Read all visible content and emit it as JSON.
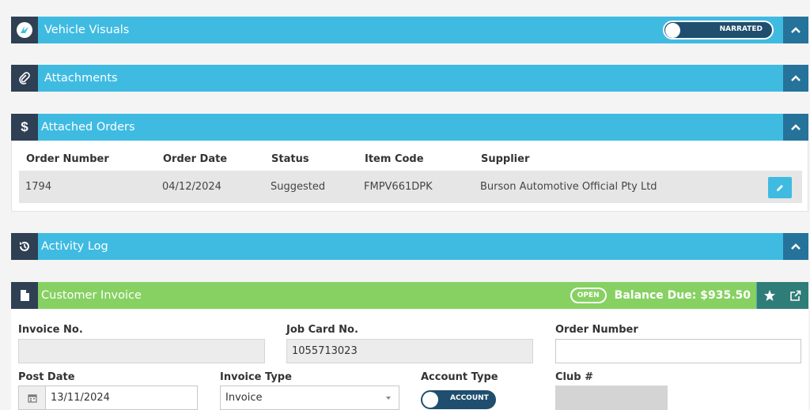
{
  "vehicle_visuals": {
    "title": "Vehicle Visuals",
    "toggle_label": "NARRATED",
    "icon": "vehicle-logo-icon"
  },
  "attachments": {
    "title": "Attachments",
    "icon": "paperclip-icon"
  },
  "attached_orders": {
    "title": "Attached Orders",
    "icon": "dollar-icon",
    "columns": [
      "Order Number",
      "Order Date",
      "Status",
      "Item Code",
      "Supplier"
    ],
    "rows": [
      {
        "order_number": "1794",
        "order_date": "04/12/2024",
        "status": "Suggested",
        "item_code": "FMPV661DPK",
        "supplier": "Burson Automotive Official Pty Ltd"
      }
    ]
  },
  "activity_log": {
    "title": "Activity Log",
    "icon": "history-icon"
  },
  "customer_invoice": {
    "title": "Customer Invoice",
    "icon": "document-icon",
    "status_badge": "OPEN",
    "balance_due": "Balance Due: $935.50",
    "fields": {
      "invoice_no": {
        "label": "Invoice No.",
        "value": ""
      },
      "job_card_no": {
        "label": "Job Card No.",
        "value": "1055713023"
      },
      "order_number": {
        "label": "Order Number",
        "value": ""
      },
      "post_date": {
        "label": "Post Date",
        "value": "13/11/2024"
      },
      "invoice_type": {
        "label": "Invoice Type",
        "value": "Invoice"
      },
      "account_type": {
        "label": "Account Type",
        "toggle_label": "ACCOUNT"
      },
      "club_no": {
        "label": "Club #"
      }
    }
  },
  "colors": {
    "panel_blue": "#3fbbe2",
    "panel_dark": "#2f4054",
    "collapse_blue": "#25739a",
    "invoice_green": "#86d162",
    "action_teal": "#2f7d78",
    "toggle_navy": "#1f4e6e"
  }
}
